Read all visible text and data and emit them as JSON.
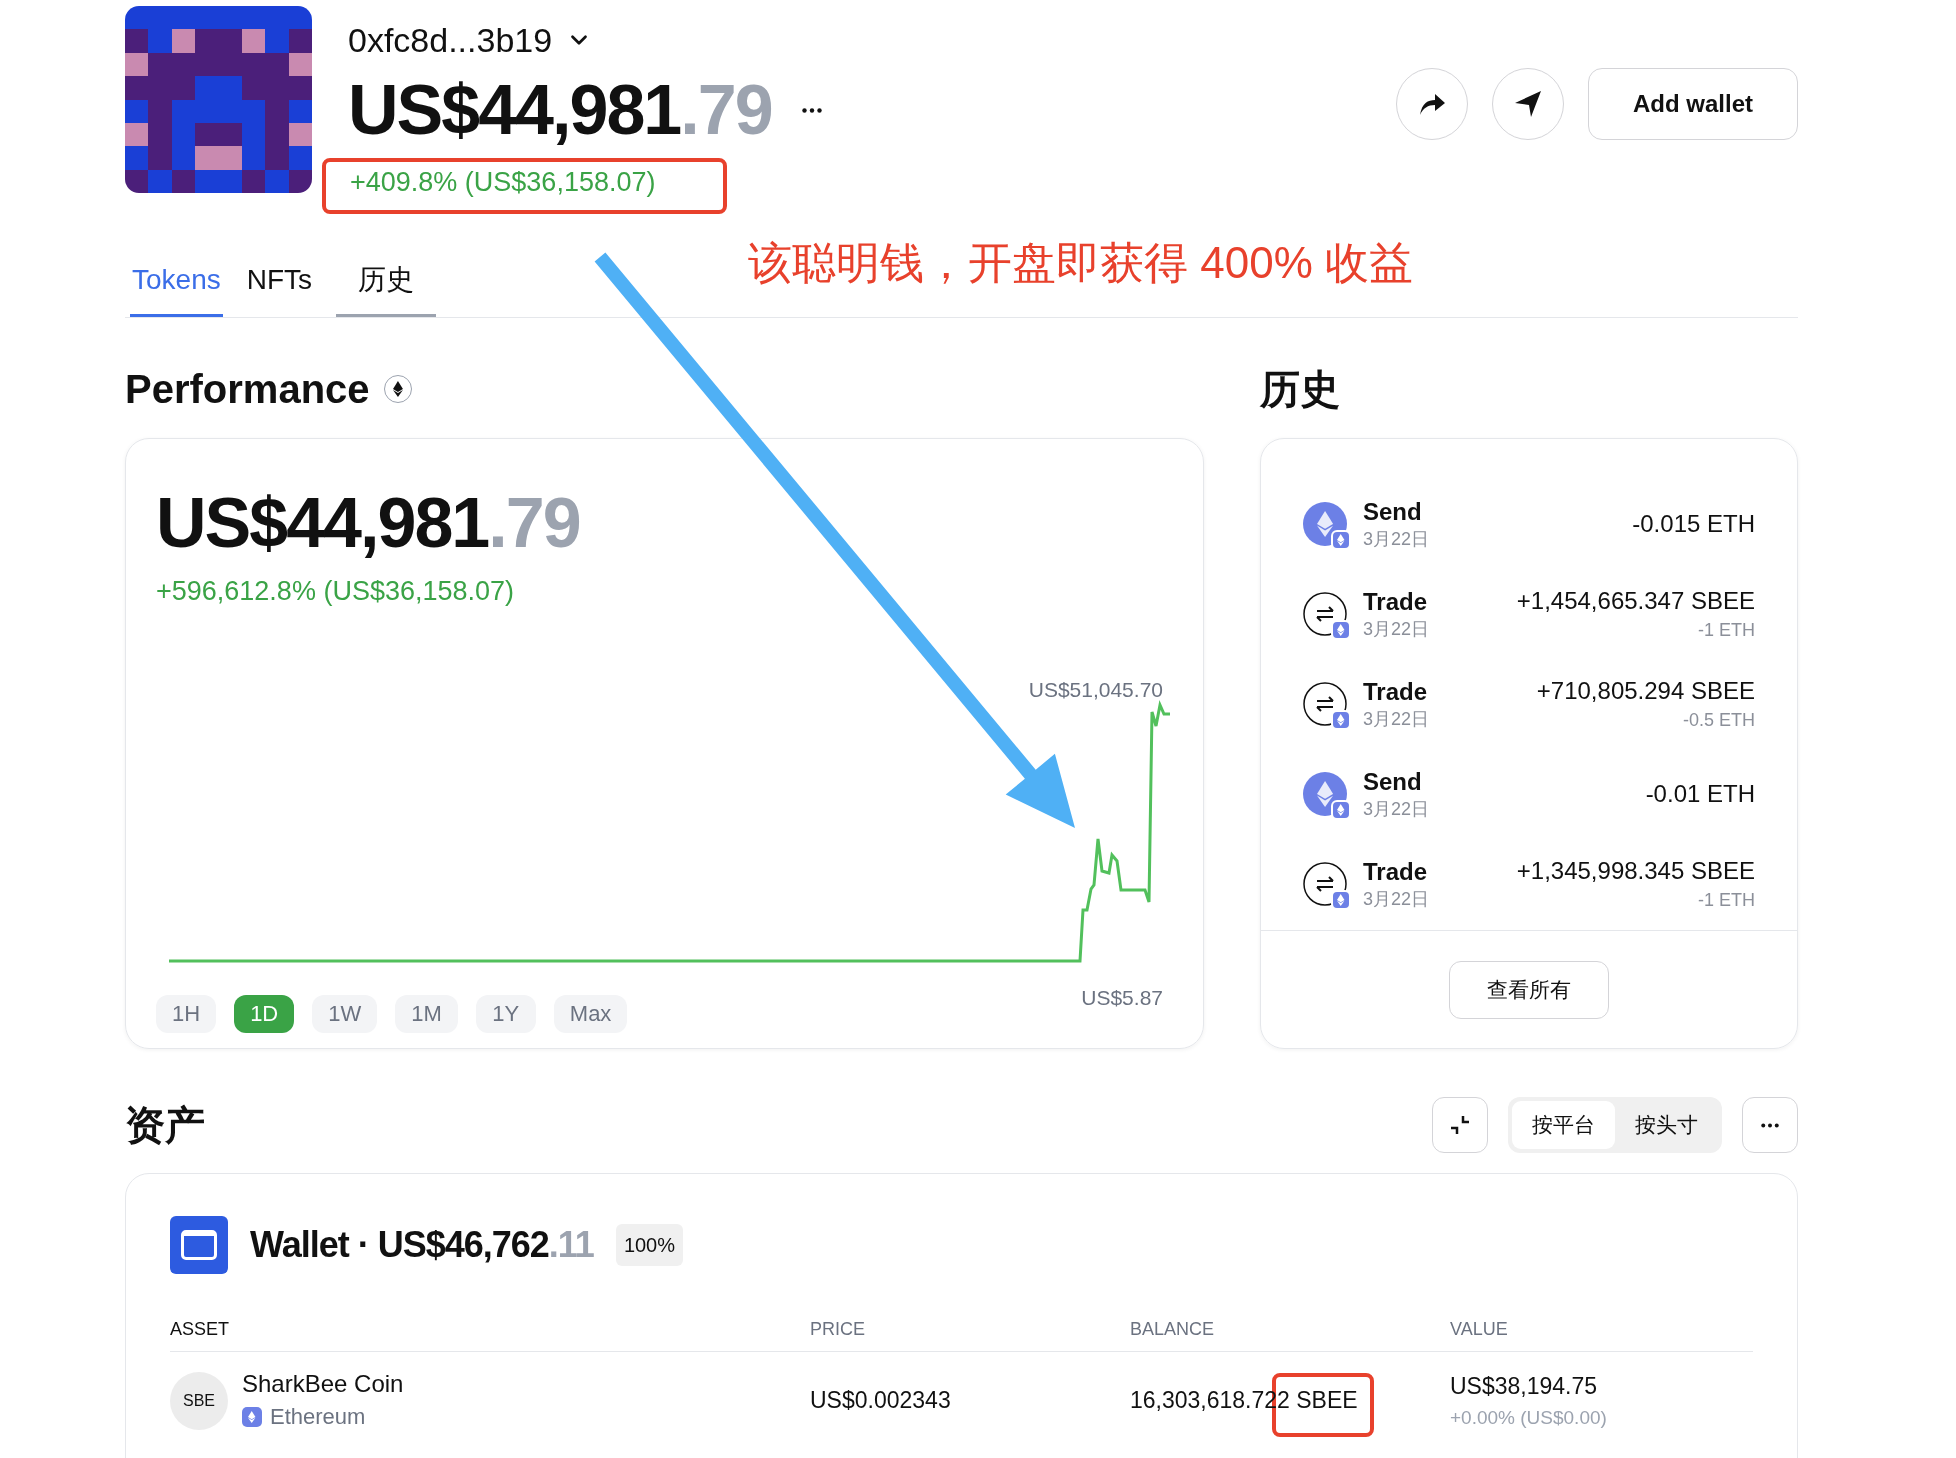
{
  "header": {
    "address": "0xfc8d...3b19",
    "balance_whole": "US$44,981",
    "balance_cents": ".79",
    "change": "+409.8% (US$36,158.07)",
    "add_wallet": "Add wallet"
  },
  "annotation": {
    "text": "该聪明钱，开盘即获得 400% 收益"
  },
  "tabs": [
    {
      "label": "Tokens",
      "selected": true,
      "hovered": false
    },
    {
      "label": "NFTs",
      "selected": false,
      "hovered": false
    },
    {
      "label": "历史",
      "selected": false,
      "hovered": true
    }
  ],
  "performance": {
    "title": "Performance",
    "balance_whole": "US$44,981",
    "balance_cents": ".79",
    "change": "+596,612.8% (US$36,158.07)",
    "high_label": "US$51,045.70",
    "low_label": "US$5.87",
    "ranges": [
      {
        "label": "1H",
        "selected": false
      },
      {
        "label": "1D",
        "selected": true
      },
      {
        "label": "1W",
        "selected": false
      },
      {
        "label": "1M",
        "selected": false
      },
      {
        "label": "1Y",
        "selected": false
      },
      {
        "label": "Max",
        "selected": false
      }
    ]
  },
  "history": {
    "title": "历史",
    "items": [
      {
        "kind": "send",
        "title": "Send",
        "date": "3月22日",
        "amount": "-0.015 ETH"
      },
      {
        "kind": "trade",
        "title": "Trade",
        "date": "3月22日",
        "amount": "+1,454,665.347 SBEE",
        "sub_amount": "-1 ETH"
      },
      {
        "kind": "trade",
        "title": "Trade",
        "date": "3月22日",
        "amount": "+710,805.294 SBEE",
        "sub_amount": "-0.5 ETH"
      },
      {
        "kind": "send",
        "title": "Send",
        "date": "3月22日",
        "amount": "-0.01 ETH"
      },
      {
        "kind": "trade",
        "title": "Trade",
        "date": "3月22日",
        "amount": "+1,345,998.345 SBEE",
        "sub_amount": "-1 ETH"
      }
    ],
    "view_all": "查看所有"
  },
  "assets": {
    "title": "资产",
    "view_toggle": [
      {
        "label": "按平台",
        "selected": true
      },
      {
        "label": "按头寸",
        "selected": false
      }
    ],
    "wallet": {
      "label": "Wallet · US$46,762",
      "cents": ".11",
      "share": "100%"
    },
    "columns": [
      "ASSET",
      "PRICE",
      "BALANCE",
      "VALUE"
    ],
    "rows": [
      {
        "icon_text": "SBE",
        "name": "SharkBee Coin",
        "network": "Ethereum",
        "price": "US$0.002343",
        "balance": "16,303,618.722 SBEE",
        "value": "US$38,194.75",
        "value_change": "+0.00% (US$0.00)"
      }
    ]
  }
}
